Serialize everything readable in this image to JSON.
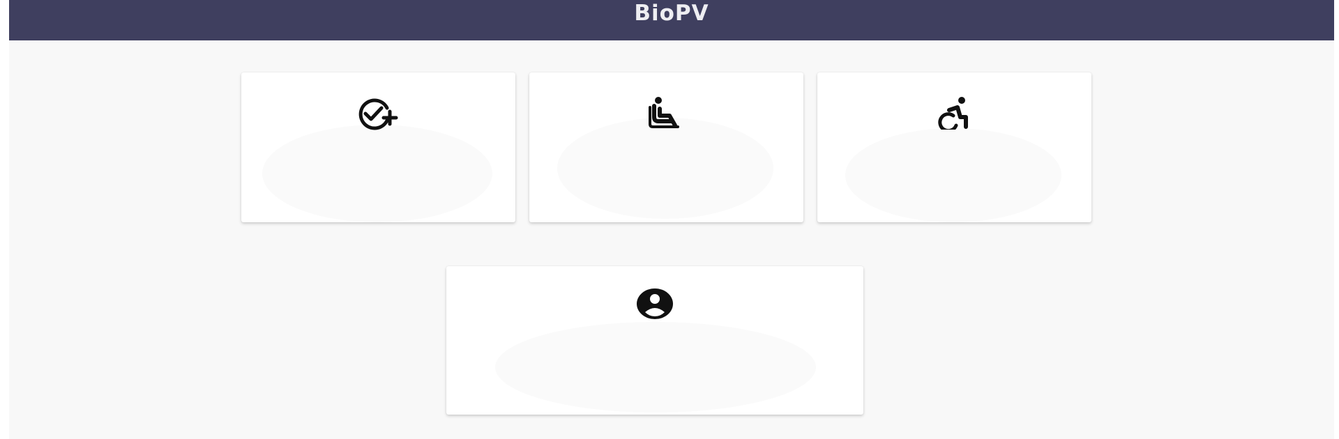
{
  "app": {
    "title": "BioPV",
    "header_color": "#3f3f5f",
    "background_color": "#f8f8f8"
  },
  "cards": [
    {
      "icon": "check-circle-plus-icon",
      "label": ""
    },
    {
      "icon": "seated-person-icon",
      "label": ""
    },
    {
      "icon": "wheelchair-accessible-icon",
      "label": ""
    },
    {
      "icon": "account-circle-icon",
      "label": ""
    }
  ]
}
